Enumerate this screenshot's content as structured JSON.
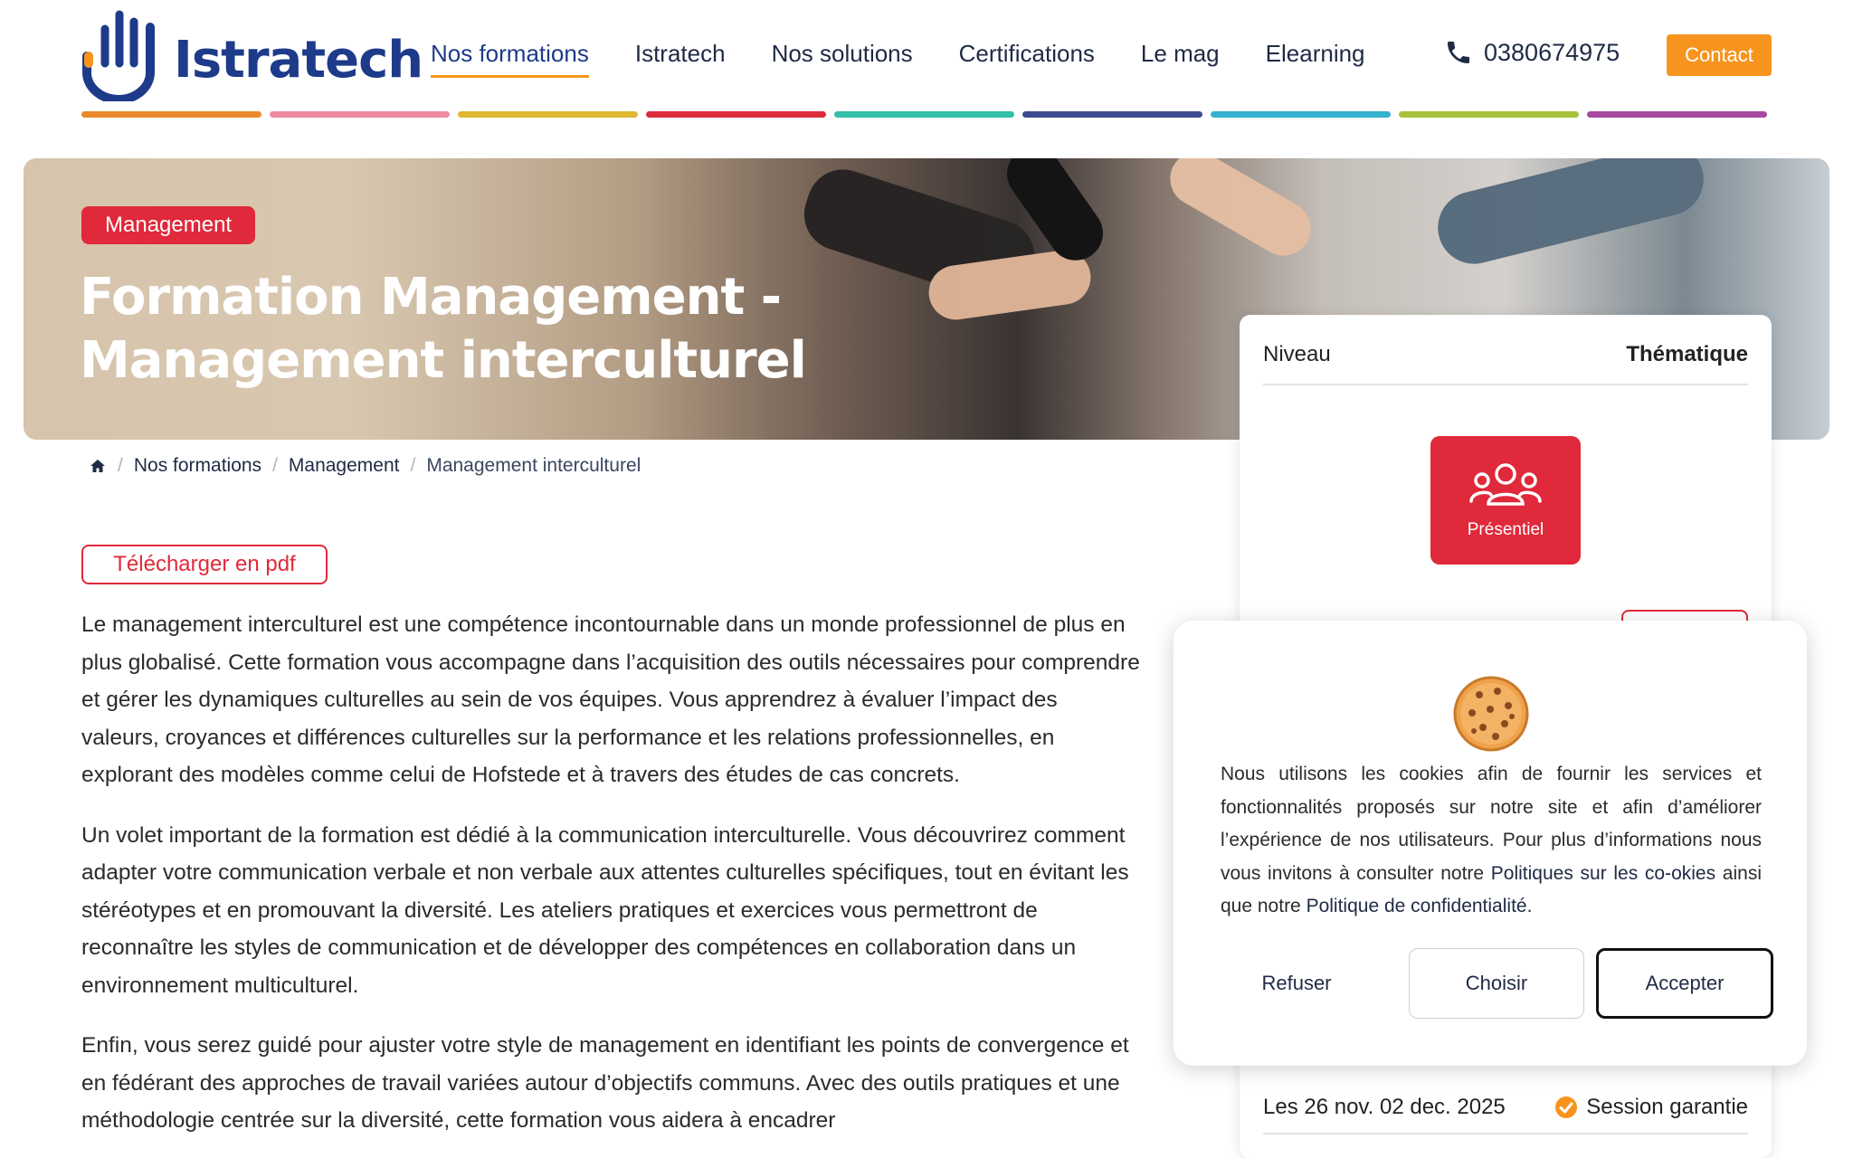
{
  "header": {
    "logo_text": "Istratech",
    "nav": [
      {
        "label": "Nos formations",
        "active": true
      },
      {
        "label": "Istratech",
        "active": false
      },
      {
        "label": "Nos solutions",
        "active": false
      },
      {
        "label": "Certifications",
        "active": false
      },
      {
        "label": "Le mag",
        "active": false
      },
      {
        "label": "Elearning",
        "active": false
      }
    ],
    "phone": "0380674975",
    "contact_label": "Contact",
    "stripe_colors": [
      "#e8892b",
      "#ef8aa0",
      "#e0b832",
      "#dc2d3c",
      "#33bfa9",
      "#3f4a8f",
      "#35b2cf",
      "#a7c23a",
      "#a84a9f"
    ]
  },
  "hero": {
    "badge": "Management",
    "title": "Formation Management - Management interculturel"
  },
  "breadcrumb": {
    "items": [
      "Nos formations",
      "Management"
    ],
    "current": "Management interculturel"
  },
  "main": {
    "pdf_label": "Télécharger en pdf",
    "paragraphs": [
      "Le management interculturel est une compétence incontournable dans un monde professionnel de plus en plus globalisé. Cette formation vous accompagne dans l’acquisition des outils nécessaires pour comprendre et gérer les dynamiques culturelles au sein de vos équipes. Vous apprendrez à évaluer l’impact des valeurs, croyances et différences culturelles sur la performance et les relations professionnelles, en explorant des modèles comme celui de Hofstede et à travers des études de cas concrets.",
      "Un volet important de la formation est dédié à la communication interculturelle. Vous découvrirez comment adapter votre communication verbale et non verbale aux attentes culturelles spécifiques, tout en évitant les stéréotypes et en promouvant la diversité. Les ateliers pratiques et exercices vous permettront de reconnaître les styles de communication et de développer des compétences en collaboration dans un environnement multiculturel.",
      "Enfin, vous serez guidé pour ajuster votre style de management en identifiant les points de convergence et en fédérant des approches de travail variées autour d’objectifs communs. Avec des outils pratiques et une méthodologie centrée sur la diversité, cette formation vous aidera à encadrer"
    ]
  },
  "side_card": {
    "tab_left": "Niveau",
    "tab_right": "Thématique",
    "mode_label": "Présentiel",
    "session_dates": "Les 26 nov. 02 dec. 2025",
    "session_badge": "Session garantie"
  },
  "cookie": {
    "text_1": "Nous utilisons les cookies afin de fournir les services et fonctionnalités proposés sur notre site et afin d’améliorer l’expérience de nos utilisateurs. Pour plus d’informations nous vous invitons à consulter notre ",
    "link_1": "Politiques sur les co-okies",
    "text_2": " ainsi que notre ",
    "link_2": "Politique de confidentialité",
    "text_3": ".",
    "btn_refuse": "Refuser",
    "btn_choose": "Choisir",
    "btn_accept": "Accepter"
  }
}
